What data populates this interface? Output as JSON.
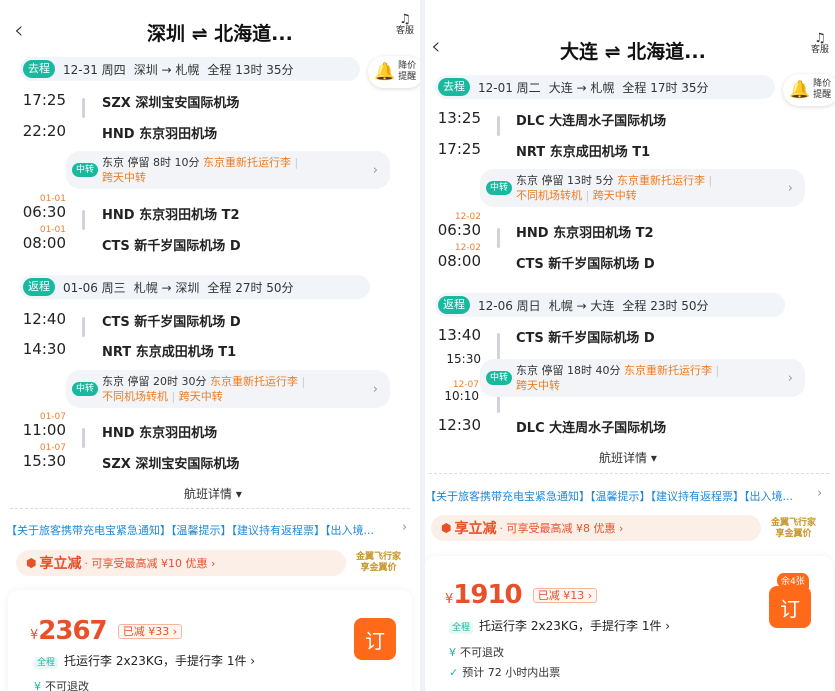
{
  "left": {
    "title": "深圳 ⇌ 北海道...",
    "customer_service": "客服",
    "price_alert": [
      "降价",
      "提醒"
    ],
    "outbound": {
      "tag": "去程",
      "date": "12-31 周四",
      "route": "深圳 → 札幌",
      "duration": "全程 13时 35分"
    },
    "out_seg1": {
      "dep_time": "17:25",
      "dep_airport": "SZX 深圳宝安国际机场",
      "arr_time": "22:20",
      "arr_airport": "HND 东京羽田机场"
    },
    "out_transfer": {
      "tag": "中转",
      "line1_city": "东京",
      "line1_stay": "停留 8时 10分",
      "line1_note": "东京重新托运行李",
      "line2": "跨天中转"
    },
    "out_seg2": {
      "dep_day": "01-01",
      "dep_time": "06:30",
      "dep_airport": "HND 东京羽田机场 T2",
      "arr_day": "01-01",
      "arr_time": "08:00",
      "arr_airport": "CTS 新千岁国际机场 D"
    },
    "return": {
      "tag": "返程",
      "date": "01-06 周三",
      "route": "札幌 → 深圳",
      "duration": "全程 27时 50分"
    },
    "ret_seg1": {
      "dep_time": "12:40",
      "dep_airport": "CTS 新千岁国际机场 D",
      "arr_time": "14:30",
      "arr_airport": "NRT 东京成田机场 T1"
    },
    "ret_transfer": {
      "tag": "中转",
      "line1_city": "东京",
      "line1_stay": "停留 20时 30分",
      "line1_note": "东京重新托运行李",
      "line2a": "不同机场转机",
      "line2b": "跨天中转"
    },
    "ret_seg2": {
      "dep_day": "01-07",
      "dep_time": "11:00",
      "dep_airport": "HND 东京羽田机场",
      "arr_day": "01-07",
      "arr_time": "15:30",
      "arr_airport": "SZX 深圳宝安国际机场"
    },
    "details": "航班详情 ▾",
    "notice": "【关于旅客携带充电宝紧急通知】【温馨提示】【建议持有返程票】【出入境...",
    "promo": {
      "main": "享立减",
      "sub": "· 可享受最高减 ¥10 优惠 ›"
    },
    "gold": [
      "金翼飞行家",
      "享金翼价"
    ],
    "offer": {
      "yen": "¥",
      "price": "2367",
      "discount": "已减 ¥33 ›",
      "book": "订",
      "bag_tag": "全程",
      "bag": "托运行李 2x23KG，手提行李 1件 ›",
      "info1": "不可退改"
    }
  },
  "right": {
    "title": "大连 ⇌ 北海道...",
    "customer_service": "客服",
    "price_alert": [
      "降价",
      "提醒"
    ],
    "outbound": {
      "tag": "去程",
      "date": "12-01 周二",
      "route": "大连 → 札幌",
      "duration": "全程 17时 35分"
    },
    "out_seg1": {
      "dep_time": "13:25",
      "dep_airport": "DLC 大连周水子国际机场",
      "arr_time": "17:25",
      "arr_airport": "NRT 东京成田机场 T1"
    },
    "out_transfer": {
      "tag": "中转",
      "line1_city": "东京",
      "line1_stay": "停留 13时 5分",
      "line1_note": "东京重新托运行李",
      "line2a": "不同机场转机",
      "line2b": "跨天中转"
    },
    "out_seg2": {
      "dep_day": "12-02",
      "dep_time": "06:30",
      "dep_airport": "HND 东京羽田机场 T2",
      "arr_day": "12-02",
      "arr_time": "08:00",
      "arr_airport": "CTS 新千岁国际机场 D"
    },
    "return": {
      "tag": "返程",
      "date": "12-06 周日",
      "route": "札幌 → 大连",
      "duration": "全程 23时 50分"
    },
    "ret_seg1": {
      "dep_time": "13:40",
      "dep_airport": "CTS 新千岁国际机场 D"
    },
    "ret_transfer": {
      "arr_time": "15:30",
      "tag": "中转",
      "line1_city": "东京",
      "line1_stay": "停留 18时 40分",
      "line1_note": "东京重新托运行李",
      "line2": "跨天中转",
      "dep_day": "12-07",
      "dep_time": "10:10"
    },
    "ret_seg2": {
      "arr_time": "12:30",
      "arr_airport": "DLC 大连周水子国际机场"
    },
    "details": "航班详情 ▾",
    "notice": "【关于旅客携带充电宝紧急通知】【温馨提示】【建议持有返程票】【出入境...",
    "promo": {
      "main": "享立减",
      "sub": "· 可享受最高减 ¥8 优惠 ›"
    },
    "gold": [
      "金翼飞行家",
      "享金翼价"
    ],
    "offer": {
      "yen": "¥",
      "price": "1910",
      "discount": "已减 ¥13 ›",
      "remain": "余4张",
      "book": "订",
      "bag_tag": "全程",
      "bag": "托运行李 2x23KG，手提行李 1件 ›",
      "info1": "不可退改",
      "info2": "预计 72 小时内出票"
    }
  }
}
